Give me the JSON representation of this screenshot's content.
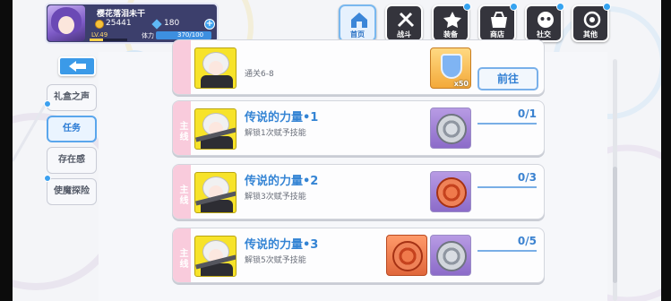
{
  "player": {
    "name": "樱花落泪未干",
    "coins": "25441",
    "gems": "180",
    "level": "LV.49",
    "level_progress": 0.35,
    "stamina_label": "体力",
    "stamina": "370/100",
    "add_label": "+"
  },
  "nav": [
    {
      "label": "首页",
      "icon": "home-icon"
    },
    {
      "label": "战斗",
      "icon": "battle-icon"
    },
    {
      "label": "装备",
      "icon": "equipment-icon"
    },
    {
      "label": "商店",
      "icon": "shop-icon"
    },
    {
      "label": "社交",
      "icon": "social-icon"
    },
    {
      "label": "其他",
      "icon": "other-icon"
    }
  ],
  "side_tabs": [
    {
      "label": "礼盒之声"
    },
    {
      "label": "任务"
    },
    {
      "label": "存在感"
    },
    {
      "label": "使魔探险"
    }
  ],
  "quests": [
    {
      "tag": "主线",
      "title": "",
      "desc": "通关6-8",
      "reward_qty": "x50",
      "action": "前往"
    },
    {
      "tag": "主线",
      "title": "传说的力量•1",
      "desc": "解锁1次赋予技能",
      "progress": "0/1"
    },
    {
      "tag": "主线",
      "title": "传说的力量•2",
      "desc": "解锁3次赋予技能",
      "progress": "0/3"
    },
    {
      "tag": "主线",
      "title": "传说的力量•3",
      "desc": "解锁5次赋予技能",
      "progress": "0/5"
    }
  ],
  "colors": {
    "accent_blue": "#3b9ae8",
    "tag_pink": "#f9cbdc",
    "portrait_yellow": "#f7e32a"
  }
}
